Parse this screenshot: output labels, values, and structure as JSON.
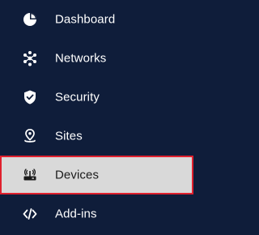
{
  "sidebar": {
    "items": [
      {
        "label": "Dashboard",
        "icon": "dashboard-pie-icon",
        "active": false
      },
      {
        "label": "Networks",
        "icon": "network-nodes-icon",
        "active": false
      },
      {
        "label": "Security",
        "icon": "shield-check-icon",
        "active": false
      },
      {
        "label": "Sites",
        "icon": "location-pin-icon",
        "active": false
      },
      {
        "label": "Devices",
        "icon": "router-icon",
        "active": true
      },
      {
        "label": "Add-ins",
        "icon": "code-brackets-icon",
        "active": false
      }
    ]
  },
  "colors": {
    "background": "#0f1d3a",
    "text": "#ffffff",
    "active_background": "#d9d9d9",
    "active_border": "#e0202d",
    "active_text": "#1a1a1a"
  }
}
